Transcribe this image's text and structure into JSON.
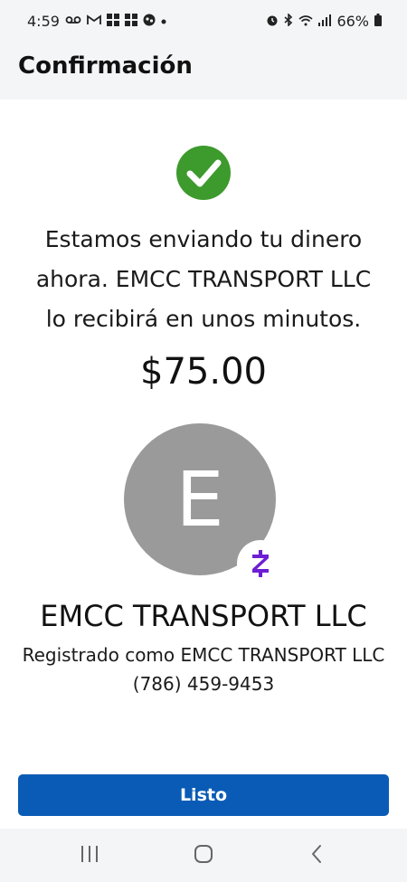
{
  "status_bar": {
    "time": "4:59",
    "left_icons": [
      "voicemail-icon",
      "gmail-icon",
      "app-grid-icon",
      "app-grid-icon",
      "game-icon",
      "dot-icon"
    ],
    "right_icons": [
      "alarm-icon",
      "bluetooth-icon",
      "wifi-icon",
      "signal-icon",
      "battery-icon"
    ],
    "battery": "66%"
  },
  "header": {
    "title": "Confirmación"
  },
  "success_icon": "checkmark-icon",
  "message": {
    "line1": "Estamos enviando tu dinero",
    "line2": "ahora. EMCC TRANSPORT LLC",
    "line3": "lo recibirá en unos minutos."
  },
  "amount": "$75.00",
  "avatar": {
    "letter": "E",
    "badge_icon": "zelle-icon"
  },
  "recipient": {
    "name": "EMCC TRANSPORT LLC",
    "registered": "Registrado como EMCC TRANSPORT LLC",
    "phone": "(786) 459-9453"
  },
  "done_button": {
    "label": "Listo"
  },
  "nav_bar": {
    "buttons": [
      "recents-icon",
      "home-icon",
      "back-icon"
    ]
  },
  "colors": {
    "accent": "#0a5bb5",
    "success": "#3d9a2d",
    "zelle": "#6d1ed4",
    "avatar": "#9a9a9a"
  }
}
